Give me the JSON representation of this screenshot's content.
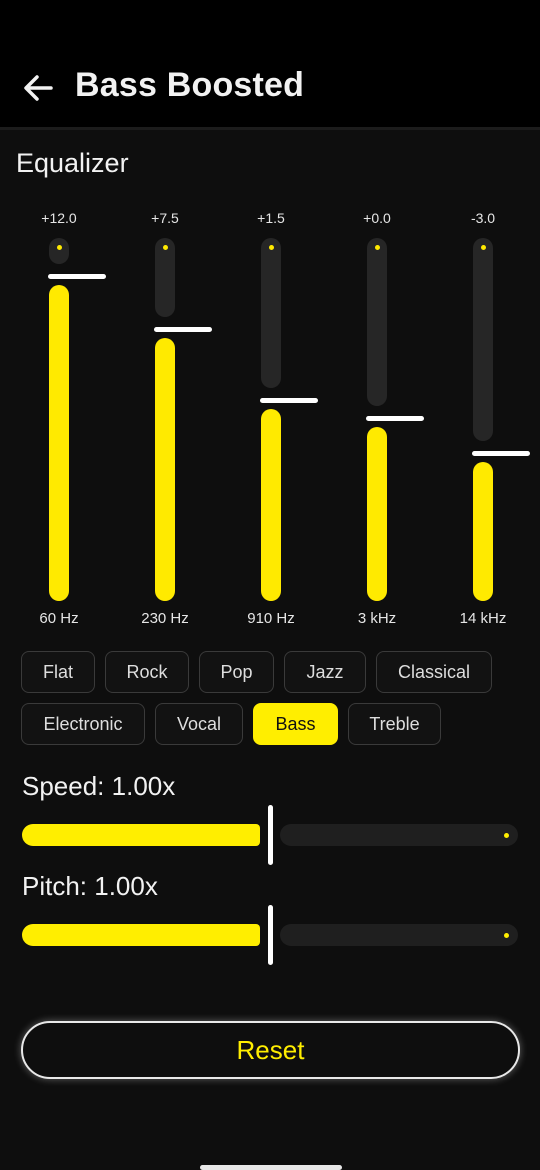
{
  "header": {
    "title": "Bass Boosted",
    "back_icon": "arrow-left-icon"
  },
  "equalizer": {
    "title": "Equalizer",
    "range_db": [
      -15,
      15
    ],
    "accent": "#ffee00",
    "bands": [
      {
        "value": "+12.0",
        "freq": "60 Hz",
        "level": 12.0
      },
      {
        "value": "+7.5",
        "freq": "230 Hz",
        "level": 7.5
      },
      {
        "value": "+1.5",
        "freq": "910 Hz",
        "level": 1.5
      },
      {
        "value": "+0.0",
        "freq": "3 kHz",
        "level": 0.0
      },
      {
        "value": "-3.0",
        "freq": "14 kHz",
        "level": -3.0
      }
    ]
  },
  "presets": [
    {
      "label": "Flat",
      "active": false
    },
    {
      "label": "Rock",
      "active": false
    },
    {
      "label": "Pop",
      "active": false
    },
    {
      "label": "Jazz",
      "active": false
    },
    {
      "label": "Classical",
      "active": false
    },
    {
      "label": "Electronic",
      "active": false
    },
    {
      "label": "Vocal",
      "active": false
    },
    {
      "label": "Bass",
      "active": true
    },
    {
      "label": "Treble",
      "active": false
    }
  ],
  "speed": {
    "label": "Speed: 1.00x",
    "fraction": 0.5
  },
  "pitch": {
    "label": "Pitch: 1.00x",
    "fraction": 0.5
  },
  "reset_label": "Reset"
}
